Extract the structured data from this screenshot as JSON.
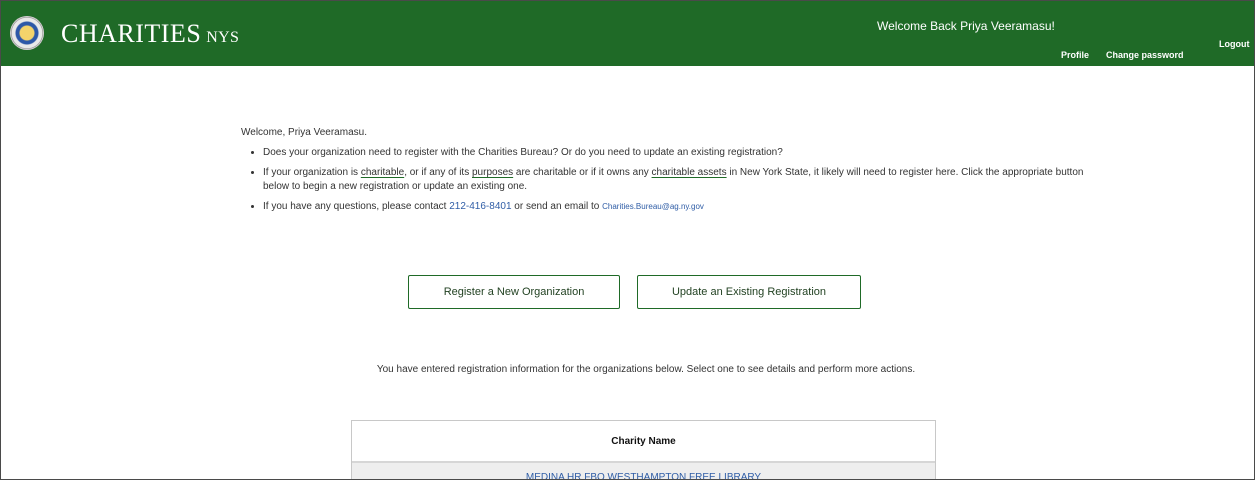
{
  "header": {
    "brand": "CHARITIES",
    "brand_suffix": "NYS",
    "welcome": "Welcome Back Priya Veeramasu!",
    "nav": {
      "profile": "Profile",
      "change_password": "Change password",
      "logout": "Logout"
    }
  },
  "intro": {
    "greeting": "Welcome, Priya Veeramasu.",
    "bullets": [
      "Does your organization need to register with the Charities Bureau? Or do you need to update an existing registration?",
      "If your organization is charitable, or if any of its purposes are charitable or if it owns any charitable assets in New York State, it likely will need to register here. Click the appropriate button below to begin a new registration or update an existing one.",
      "If you have any questions, please contact 212-416-8401 or send an email to Charities.Bureau@ag.ny.gov"
    ],
    "bullet2_parts": {
      "a": "If your organization is ",
      "b": "charitable",
      "c": ", or if any of its ",
      "d": "purposes",
      "e": " are charitable or if it owns any ",
      "f": "charitable assets",
      "g": " in New York State, it likely will need to register here. Click the appropriate button below to begin a new registration or update an existing one."
    },
    "bullet3_parts": {
      "a": "If you have any questions, please contact ",
      "phone": "212-416-8401",
      "b": " or send an email to ",
      "email": "Charities.Bureau@ag.ny.gov"
    }
  },
  "actions": {
    "register": "Register a New Organization",
    "update": "Update an Existing Registration"
  },
  "info_text": "You have entered registration information for the organizations below. Select one to see details and perform more actions.",
  "table": {
    "header": "Charity Name",
    "rows": [
      "MEDINA HR FBO WESTHAMPTON FREE LIBRARY"
    ]
  },
  "colors": {
    "brand_green": "#1f6a27",
    "link_blue": "#2f5da6"
  }
}
